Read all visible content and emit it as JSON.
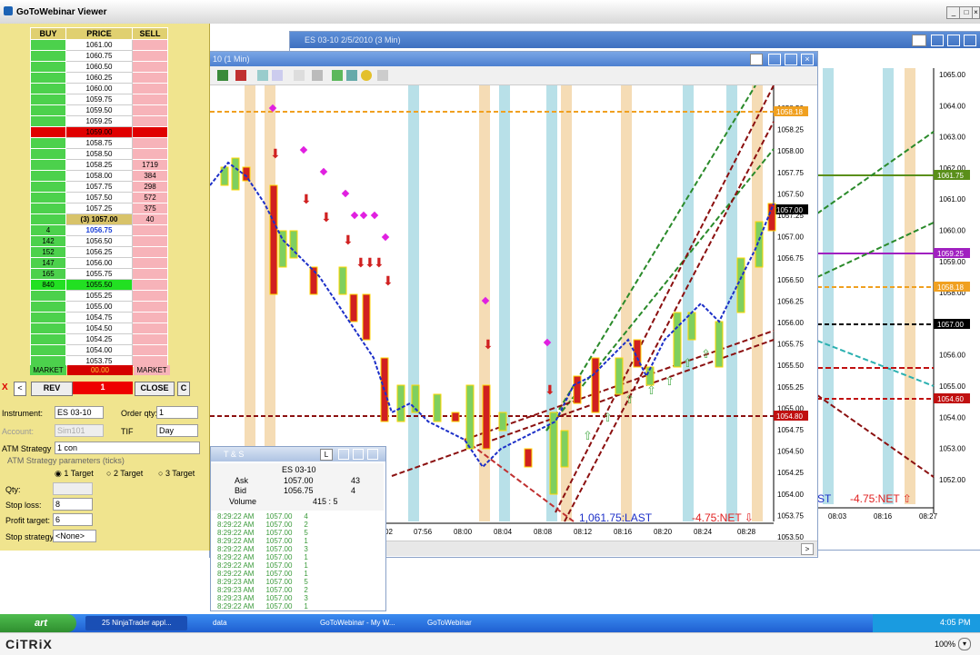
{
  "viewer": {
    "title": "GoToWebinar Viewer",
    "btn_min": "_",
    "btn_max": "□",
    "btn_close": "×"
  },
  "dom": {
    "headers": {
      "buy": "BUY",
      "price": "PRICE",
      "sell": "SELL"
    },
    "rows": [
      {
        "buy": "",
        "price": "1061.00",
        "sell": ""
      },
      {
        "buy": "",
        "price": "1060.75",
        "sell": ""
      },
      {
        "buy": "",
        "price": "1060.50",
        "sell": ""
      },
      {
        "buy": "",
        "price": "1060.25",
        "sell": ""
      },
      {
        "buy": "",
        "price": "1060.00",
        "sell": ""
      },
      {
        "buy": "",
        "price": "1059.75",
        "sell": ""
      },
      {
        "buy": "",
        "price": "1059.50",
        "sell": ""
      },
      {
        "buy": "",
        "price": "1059.25",
        "sell": ""
      },
      {
        "buy": "",
        "price": "1059.00",
        "sell": ""
      },
      {
        "buy": "",
        "price": "1058.75",
        "sell": ""
      },
      {
        "buy": "",
        "price": "1058.50",
        "sell": ""
      },
      {
        "buy": "",
        "price": "1058.25",
        "sell": "1719"
      },
      {
        "buy": "",
        "price": "1058.00",
        "sell": "384"
      },
      {
        "buy": "",
        "price": "1057.75",
        "sell": "298"
      },
      {
        "buy": "",
        "price": "1057.50",
        "sell": "572"
      },
      {
        "buy": "",
        "price": "1057.25",
        "sell": "375"
      },
      {
        "buy": "",
        "price": "(3) 1057.00",
        "sell": "40"
      },
      {
        "buy": "4",
        "price": "1056.75",
        "sell": ""
      },
      {
        "buy": "142",
        "price": "1056.50",
        "sell": ""
      },
      {
        "buy": "152",
        "price": "1056.25",
        "sell": ""
      },
      {
        "buy": "147",
        "price": "1056.00",
        "sell": ""
      },
      {
        "buy": "165",
        "price": "1055.75",
        "sell": ""
      },
      {
        "buy": "840",
        "price": "1055.50",
        "sell": ""
      },
      {
        "buy": "",
        "price": "1055.25",
        "sell": ""
      },
      {
        "buy": "",
        "price": "1055.00",
        "sell": ""
      },
      {
        "buy": "",
        "price": "1054.75",
        "sell": ""
      },
      {
        "buy": "",
        "price": "1054.50",
        "sell": ""
      },
      {
        "buy": "",
        "price": "1054.25",
        "sell": ""
      },
      {
        "buy": "",
        "price": "1054.00",
        "sell": ""
      },
      {
        "buy": "",
        "price": "1053.75",
        "sell": ""
      }
    ],
    "market_left": "MARKET",
    "market_center": "00.00",
    "market_right": "MARKET",
    "x_left": "X",
    "lt": "<",
    "rev": "REV",
    "qty_val": "1",
    "close": "CLOSE",
    "c": "C",
    "instrument_label": "Instrument:",
    "instrument_val": "ES 03-10",
    "order_qty_label": "Order qty:",
    "order_qty_val": "1",
    "account_label": "Account:",
    "account_val": "Sim101",
    "tif_label": "TIF",
    "tif_val": "Day",
    "atm_label": "ATM Strategy",
    "atm_val": "1 con",
    "atm_params": "ATM Strategy parameters (ticks)",
    "t1": "1 Target",
    "t2": "2 Target",
    "t3": "3 Target",
    "qty_label": "Qty:",
    "stoploss_label": "Stop loss:",
    "stoploss_val": "8",
    "profit_label": "Profit target:",
    "profit_val": "6",
    "stopstrat_label": "Stop strategy:",
    "stopstrat_val": "<None>"
  },
  "chart_win_title": "ES 03-10  2/5/2010 (3 Min)",
  "chart1": {
    "title": "10 (1 Min)",
    "yticks": [
      "1058.50",
      "1058.25",
      "1058.00",
      "1057.75",
      "1057.50",
      "1057.25",
      "1057.00",
      "1056.75",
      "1056.50",
      "1056.25",
      "1056.00",
      "1055.75",
      "1055.50",
      "1055.25",
      "1055.00",
      "1054.75",
      "1054.50",
      "1054.25",
      "1054.00",
      "1053.75",
      "1053.50"
    ],
    "xticks": [
      "07:56",
      "08:00",
      "08:04",
      "08:08",
      "08:12",
      "08:16",
      "08:20",
      "08:24",
      "08:28"
    ],
    "tags": [
      {
        "text": "1058.18",
        "color": "#f0a020"
      },
      {
        "text": "1057.00",
        "color": "#000000"
      },
      {
        "text": "1054.80",
        "color": "#c01010"
      }
    ],
    "last": "1,061.75:LAST",
    "net": "-4.75:NET ⇩",
    "time_left_stub": "02"
  },
  "chart2": {
    "yticks": [
      "1065.00",
      "1064.00",
      "1063.00",
      "1062.00",
      "1061.00",
      "1060.00",
      "1059.00",
      "1058.00",
      "1057.00",
      "1056.00",
      "1055.00",
      "1054.00",
      "1053.00",
      "1052.00"
    ],
    "xticks": [
      "08:03",
      "08:16",
      "08:27"
    ],
    "tags": [
      {
        "text": "1061.75",
        "color": "#5a8f1a"
      },
      {
        "text": "1059.25",
        "color": "#a020c0"
      },
      {
        "text": "1058.18",
        "color": "#f0a020"
      },
      {
        "text": "1057.00",
        "color": "#000000"
      },
      {
        "text": "1054.60",
        "color": "#c01010"
      }
    ],
    "net": "-4.75:NET ⇧",
    "last_stub": "ST"
  },
  "ts": {
    "title": "T & S",
    "instrument": "ES 03-10",
    "ask_label": "Ask",
    "ask_val": "1057.00",
    "ask_size": "43",
    "bid_label": "Bid",
    "bid_val": "1056.75",
    "bid_size": "4",
    "vol_label": "Volume",
    "vol_val": "415 : 5",
    "rows": [
      {
        "t": "8:29:22 AM",
        "p": "1057.00",
        "s": "4"
      },
      {
        "t": "8:29:22 AM",
        "p": "1057.00",
        "s": "2"
      },
      {
        "t": "8:29:22 AM",
        "p": "1057.00",
        "s": "5"
      },
      {
        "t": "8:29:22 AM",
        "p": "1057.00",
        "s": "1"
      },
      {
        "t": "8:29:22 AM",
        "p": "1057.00",
        "s": "3"
      },
      {
        "t": "8:29:22 AM",
        "p": "1057.00",
        "s": "1"
      },
      {
        "t": "8:29:22 AM",
        "p": "1057.00",
        "s": "1"
      },
      {
        "t": "8:29:22 AM",
        "p": "1057.00",
        "s": "1"
      },
      {
        "t": "8:29:23 AM",
        "p": "1057.00",
        "s": "5"
      },
      {
        "t": "8:29:23 AM",
        "p": "1057.00",
        "s": "2"
      },
      {
        "t": "8:29:23 AM",
        "p": "1057.00",
        "s": "3"
      },
      {
        "t": "8:29:22 AM",
        "p": "1057.00",
        "s": "1"
      }
    ]
  },
  "taskbar": {
    "start": "art",
    "items": [
      "25 NinjaTrader appl...",
      "data",
      "GoToWebinar - My W...",
      "GoToWebinar"
    ],
    "clock": "4:05 PM"
  },
  "citrix": {
    "logo": "CiTRiX",
    "zoom": "100%"
  }
}
